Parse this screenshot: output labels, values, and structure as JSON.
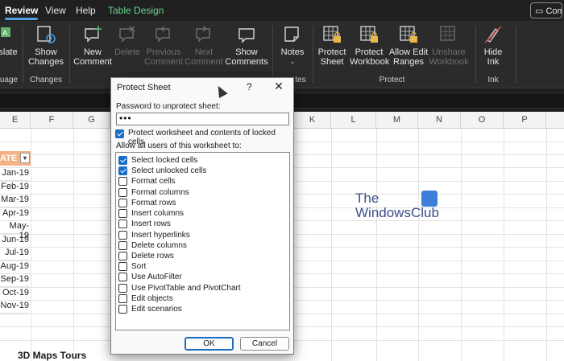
{
  "menubar": {
    "tabs": [
      "Review",
      "View",
      "Help",
      "Table Design"
    ],
    "comments_label": "Com"
  },
  "ribbon": {
    "buttons": [
      {
        "label": "slate",
        "group": "Language",
        "disabled": false
      },
      {
        "label": "Show Changes",
        "disabled": false
      },
      {
        "label": "New Comment",
        "disabled": false
      },
      {
        "label": "Delete",
        "disabled": true
      },
      {
        "label": "Previous Comment",
        "disabled": true
      },
      {
        "label": "Next Comment",
        "disabled": true
      },
      {
        "label": "Show Comments",
        "disabled": false
      },
      {
        "label": "Notes",
        "disabled": false
      },
      {
        "label": "Protect Sheet",
        "disabled": false
      },
      {
        "label": "Protect Workbook",
        "disabled": false
      },
      {
        "label": "Allow Edit Ranges",
        "disabled": false
      },
      {
        "label": "Unshare Workbook",
        "disabled": true
      },
      {
        "label": "Hide Ink",
        "disabled": false
      }
    ],
    "groups": [
      "uage",
      "Changes",
      "tes",
      "Protect",
      "Ink"
    ]
  },
  "columns": [
    "E",
    "F",
    "G",
    "K",
    "L",
    "M",
    "N",
    "O",
    "P"
  ],
  "sheet": {
    "header_cell": "ATE",
    "dates": [
      "Jan-19",
      "Feb-19",
      "Mar-19",
      "Apr-19",
      "May-19",
      "Jun-19",
      "Jul-19",
      "Aug-19",
      "Sep-19",
      "Oct-19",
      "Nov-19"
    ],
    "maps_title": "3D Maps Tours"
  },
  "watermark": {
    "line1": "The",
    "line2": "WindowsClub"
  },
  "dialog": {
    "title": "Protect Sheet",
    "help": "?",
    "close": "✕",
    "password_label": "Password to unprotect sheet:",
    "password_value": "•••",
    "protect_label": "Protect worksheet and contents of locked cells",
    "protect_checked": true,
    "allow_label": "Allow all users of this worksheet to:",
    "permissions": [
      {
        "label": "Select locked cells",
        "checked": true
      },
      {
        "label": "Select unlocked cells",
        "checked": true
      },
      {
        "label": "Format cells",
        "checked": false
      },
      {
        "label": "Format columns",
        "checked": false
      },
      {
        "label": "Format rows",
        "checked": false
      },
      {
        "label": "Insert columns",
        "checked": false
      },
      {
        "label": "Insert rows",
        "checked": false
      },
      {
        "label": "Insert hyperlinks",
        "checked": false
      },
      {
        "label": "Delete columns",
        "checked": false
      },
      {
        "label": "Delete rows",
        "checked": false
      },
      {
        "label": "Sort",
        "checked": false
      },
      {
        "label": "Use AutoFilter",
        "checked": false
      },
      {
        "label": "Use PivotTable and PivotChart",
        "checked": false
      },
      {
        "label": "Edit objects",
        "checked": false
      },
      {
        "label": "Edit scenarios",
        "checked": false
      }
    ],
    "ok_label": "OK",
    "cancel_label": "Cancel"
  }
}
